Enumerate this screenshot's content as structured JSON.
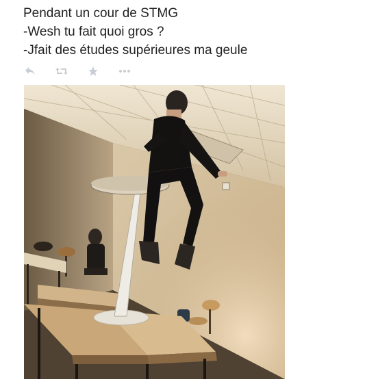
{
  "tweet": {
    "lines": [
      "Pendant un cour de STMG",
      "-Wesh tu fait quoi gros ?",
      "-Jfait des études supérieures ma geule"
    ]
  },
  "actions": {
    "icons": [
      "reply-icon",
      "retweet-icon",
      "favorite-icon",
      "more-icon"
    ],
    "icon_color": "#c9ced4"
  },
  "photo": {
    "description_icon": "photo-classroom"
  }
}
